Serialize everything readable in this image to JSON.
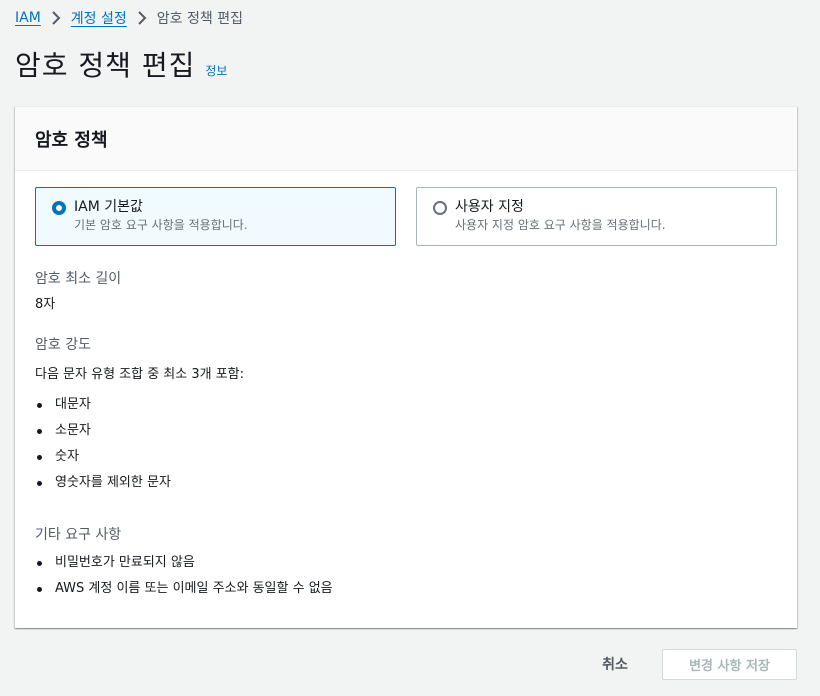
{
  "breadcrumb": {
    "items": [
      {
        "label": "IAM"
      },
      {
        "label": "계정 설정"
      },
      {
        "label": "암호 정책 편집"
      }
    ]
  },
  "header": {
    "title": "암호 정책 편집",
    "info_label": "정보"
  },
  "panel": {
    "title": "암호 정책",
    "options": [
      {
        "label": "IAM 기본값",
        "description": "기본 암호 요구 사항을 적용합니다.",
        "selected": true
      },
      {
        "label": "사용자 지정",
        "description": "사용자 지정 암호 요구 사항을 적용합니다.",
        "selected": false
      }
    ],
    "min_length": {
      "label": "암호 최소 길이",
      "value": "8자"
    },
    "strength": {
      "label": "암호 강도",
      "intro": "다음 문자 유형 조합 중 최소 3개 포함:",
      "items": [
        "대문자",
        "소문자",
        "숫자",
        "영숫자를 제외한 문자"
      ]
    },
    "other": {
      "label": "기타 요구 사항",
      "items": [
        "비밀번호가 만료되지 않음",
        "AWS 계정 이름 또는 이메일 주소와 동일할 수 없음"
      ]
    }
  },
  "footer": {
    "cancel_label": "취소",
    "save_label": "변경 사항 저장"
  },
  "colors": {
    "link": "#0073bb",
    "background": "#f2f3f3",
    "selected_tile_bg": "#f1faff",
    "disabled_text": "#aab7b8"
  }
}
